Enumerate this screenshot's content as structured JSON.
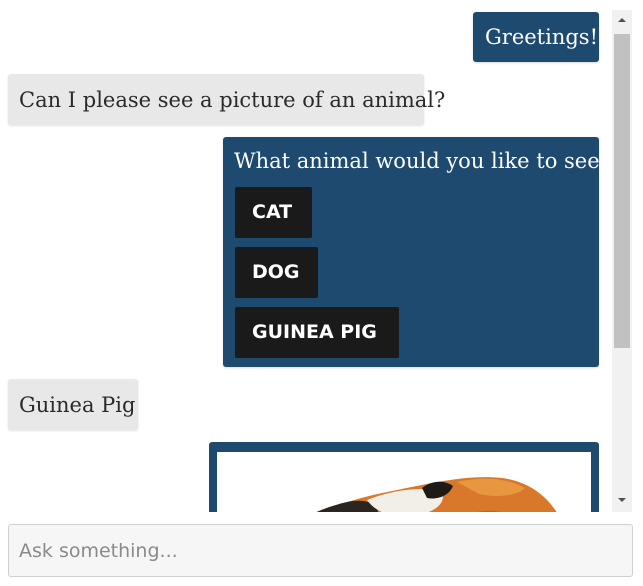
{
  "messages": [
    {
      "sender": "bot",
      "text": "Greetings!"
    },
    {
      "sender": "user",
      "text": "Can I please see a picture of an animal?"
    },
    {
      "sender": "bot",
      "text": "What animal would you like to see?",
      "choices": [
        "CAT",
        "DOG",
        "GUINEA PIG"
      ]
    },
    {
      "sender": "user",
      "text": "Guinea Pig"
    },
    {
      "sender": "bot",
      "type": "image",
      "image_subject": "guinea-pig"
    }
  ],
  "input": {
    "placeholder": "Ask something...",
    "value": ""
  },
  "colors": {
    "bot_bubble": "#1f4a70",
    "user_bubble": "#e8e8e8",
    "choice_button": "#1a1a1a",
    "scrollbar_track": "#f1f1f1",
    "scrollbar_thumb": "#c1c1c1"
  },
  "icons": {
    "scroll_up": "triangle-up-icon",
    "scroll_down": "triangle-down-icon"
  }
}
